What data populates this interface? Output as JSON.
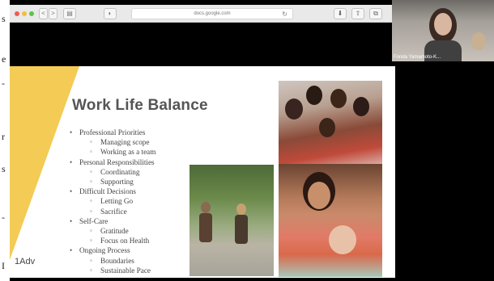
{
  "left_edge": {
    "glyphs": [
      "s",
      "e",
      "-",
      "r",
      "s",
      "-",
      "I"
    ]
  },
  "browser": {
    "url": "docs.google.com",
    "nav_back": "<",
    "nav_forward": ">",
    "sidebar_icon": "▤",
    "shield_icon": "◐",
    "reload_icon": "↻",
    "download_icon": "⬇",
    "share_icon": "⇧",
    "tabs_icon": "⧉"
  },
  "slide": {
    "title": "Work Life Balance",
    "logo": "1Adv",
    "accent_color": "#f3cb55",
    "bullets": [
      {
        "level": "main",
        "text": "Professional Priorities"
      },
      {
        "level": "sub",
        "text": "Managing scope"
      },
      {
        "level": "sub",
        "text": "Working as a team"
      },
      {
        "level": "main",
        "text": "Personal Responsibilities"
      },
      {
        "level": "sub",
        "text": "Coordinating"
      },
      {
        "level": "sub",
        "text": "Supporting"
      },
      {
        "level": "main",
        "text": "Difficult Decisions"
      },
      {
        "level": "sub",
        "text": "Letting Go"
      },
      {
        "level": "sub",
        "text": "Sacrifice"
      },
      {
        "level": "main",
        "text": "Self-Care"
      },
      {
        "level": "sub",
        "text": "Gratitude"
      },
      {
        "level": "sub",
        "text": "Focus on Health"
      },
      {
        "level": "main",
        "text": "Ongoing Process"
      },
      {
        "level": "sub",
        "text": "Boundaries"
      },
      {
        "level": "sub",
        "text": "Sustainable Pace"
      }
    ]
  },
  "video": {
    "participant_name": "Fonda Yamamoto-K..."
  }
}
